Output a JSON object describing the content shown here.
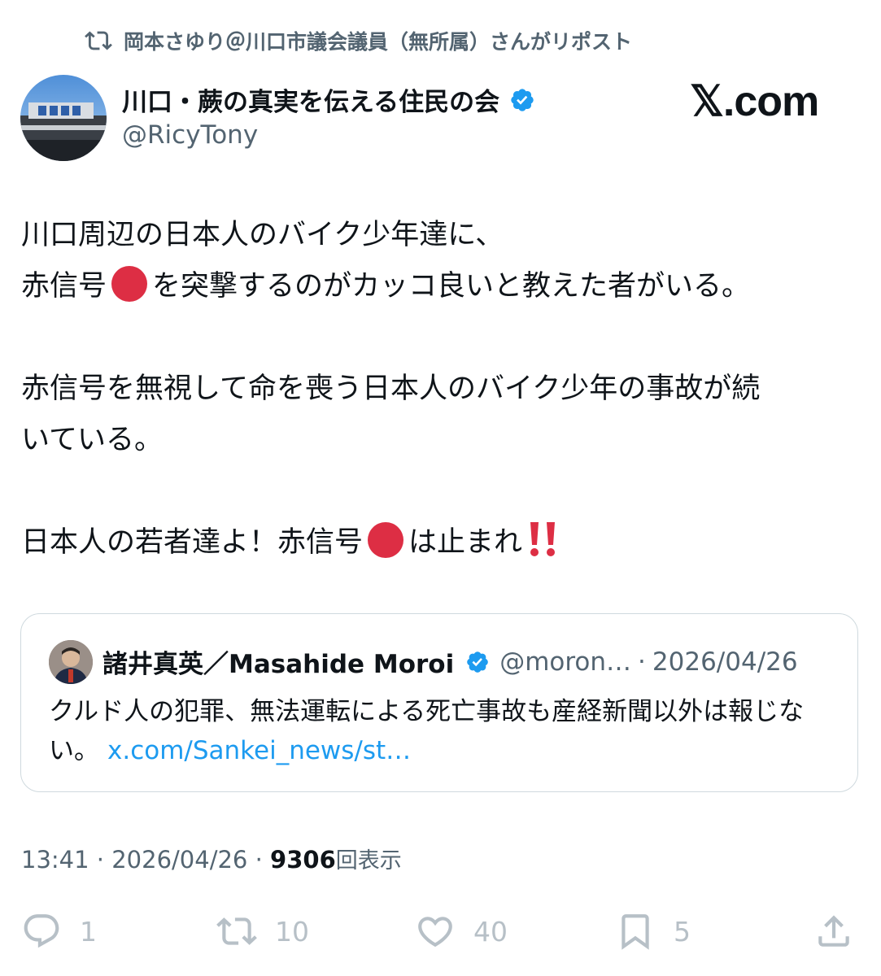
{
  "repost": {
    "text": "岡本さゆり＠川口市議会議員（無所属）さんがリポスト"
  },
  "author": {
    "name": "川口・蕨の真実を伝える住民の会",
    "handle": "@RicyTony"
  },
  "watermark": "𝕏.com",
  "post": {
    "line1": "川口周辺の日本人のバイク少年達に、",
    "line2a": "赤信号",
    "line2b": "を突撃するのがカッコ良いと教えた者がいる。",
    "line3": "赤信号を無視して命を喪う日本人のバイク少年の事故が続",
    "line4": "いている。",
    "line5a": "日本人の若者達よ！赤信号",
    "line5b": "は止まれ"
  },
  "emoji": {
    "red_circle": "red-circle-icon",
    "exclamation": "double-exclamation-icon"
  },
  "quote": {
    "name": "諸井真英／Masahide Moroi",
    "handle": "@moron…",
    "separator": "·",
    "date": "2026/04/26",
    "text": "クルド人の犯罪、無法運転による死亡事故も産経新聞以外は報じない。",
    "link": "x.com/Sankei_news/st…"
  },
  "meta": {
    "time": "13:41",
    "dot1": "·",
    "date": "2026/04/26",
    "dot2": "·",
    "views": "9306",
    "views_label": "回表示"
  },
  "actions": {
    "replies": "1",
    "reposts": "10",
    "likes": "40",
    "bookmarks": "5"
  },
  "colors": {
    "verified": "#1d9bf0",
    "muted": "#536471",
    "link": "#1d9bf0",
    "red_circle": "#dd2e44"
  }
}
